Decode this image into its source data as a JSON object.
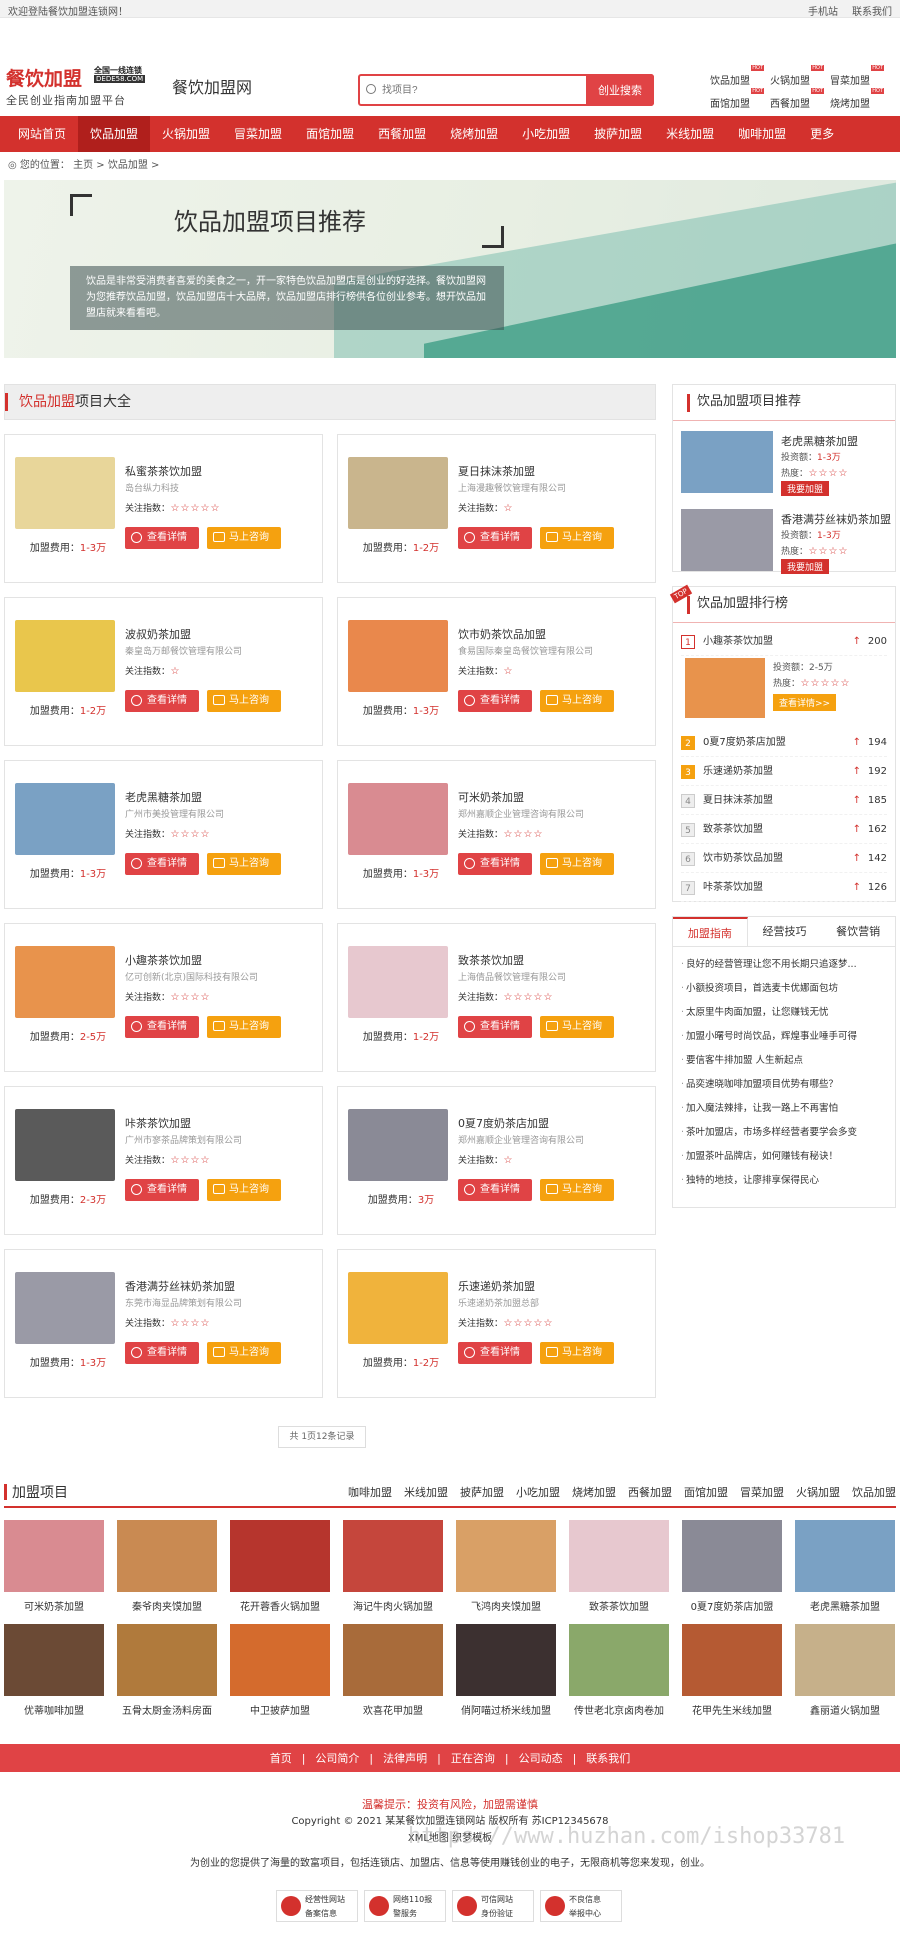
{
  "topbar": {
    "welcome": "欢迎登陆餐饮加盟连锁网！",
    "mobile": "手机站",
    "contact": "联系我们"
  },
  "header": {
    "logo_main": "餐饮加盟",
    "logo_badge": "全国一线连锁",
    "logo_domain": "DEDE58.COM",
    "logo_slogan": "全民创业指南加盟平台",
    "site_name": "餐饮加盟网",
    "search_placeholder": "找项目?",
    "search_button": "创业搜索",
    "hot_links": [
      "饮品加盟",
      "火锅加盟",
      "冒菜加盟",
      "面馆加盟",
      "西餐加盟",
      "烧烤加盟"
    ],
    "hot_tag": "HOT"
  },
  "nav": [
    "网站首页",
    "饮品加盟",
    "火锅加盟",
    "冒菜加盟",
    "面馆加盟",
    "西餐加盟",
    "烧烤加盟",
    "小吃加盟",
    "披萨加盟",
    "米线加盟",
    "咖啡加盟",
    "更多"
  ],
  "breadcrumb": {
    "prefix": "您的位置：",
    "home": "主页",
    "sep": ">",
    "current": "饮品加盟",
    "end": ">"
  },
  "banner": {
    "title": "饮品加盟项目推荐",
    "desc": "饮品是非常受消费者喜爱的美食之一，开一家特色饮品加盟店是创业的好选择。餐饮加盟网为您推荐饮品加盟，饮品加盟店十大品牌，饮品加盟店排行榜供各位创业参考。想开饮品加盟店就来看看吧。"
  },
  "list": {
    "heading_hl": "饮品加盟",
    "heading_rest": "项目大全",
    "fee_label": "加盟费用：",
    "attn_label": "关注指数：",
    "detail_btn": "查看详情",
    "consult_btn": "马上咨询",
    "pager": "共 1页12条记录",
    "items": [
      {
        "title": "私蜜茶茶饮加盟",
        "company": "岛台纵力科技",
        "fee": "1-3万",
        "stars": 5,
        "color": "#e8d69a"
      },
      {
        "title": "夏日抹沫茶加盟",
        "company": "上海漫趣餐饮管理有限公司",
        "fee": "1-2万",
        "stars": 1,
        "color": "#c9b58d"
      },
      {
        "title": "波叔奶茶加盟",
        "company": "秦皇岛万邮餐饮管理有限公司",
        "fee": "1-2万",
        "stars": 1,
        "color": "#e9c64c"
      },
      {
        "title": "饮市奶茶饮品加盟",
        "company": "食易国际秦皇岛餐饮管理有限公司",
        "fee": "1-3万",
        "stars": 1,
        "color": "#e9884c"
      },
      {
        "title": "老虎黑糖茶加盟",
        "company": "广州市美投管理有限公司",
        "fee": "1-3万",
        "stars": 4,
        "color": "#7aa1c4"
      },
      {
        "title": "可米奶茶加盟",
        "company": "郑州嘉顺企业管理咨询有限公司",
        "fee": "1-3万",
        "stars": 4,
        "color": "#d98b91"
      },
      {
        "title": "小趣茶茶饮加盟",
        "company": "亿可创新(北京)国际科技有限公司",
        "fee": "2-5万",
        "stars": 4,
        "color": "#e8934c"
      },
      {
        "title": "致茶茶饮加盟",
        "company": "上海倩品餐饮管理有限公司",
        "fee": "1-2万",
        "stars": 5,
        "color": "#e7c8cf"
      },
      {
        "title": "咔茶茶饮加盟",
        "company": "广州市寥茶品牌策划有限公司",
        "fee": "2-3万",
        "stars": 4,
        "color": "#5a5a5a"
      },
      {
        "title": "0夏7度奶茶店加盟",
        "company": "郑州嘉顺企业管理咨询有限公司",
        "fee": "3万",
        "stars": 1,
        "color": "#8a8a96"
      },
      {
        "title": "香港满芬丝袜奶茶加盟",
        "company": "东莞市海显品牌策划有限公司",
        "fee": "1-3万",
        "stars": 4,
        "color": "#9a9aa6"
      },
      {
        "title": "乐速递奶茶加盟",
        "company": "乐速递奶茶加盟总部",
        "fee": "1-2万",
        "stars": 5,
        "color": "#f0b33c"
      }
    ]
  },
  "side_rec": {
    "heading": "饮品加盟项目推荐",
    "inv_label": "投资额：",
    "heat_label": "热度：",
    "join_btn": "我要加盟",
    "items": [
      {
        "title": "老虎黑糖茶加盟",
        "inv": "1-3万",
        "stars": 4,
        "color": "#7aa1c4"
      },
      {
        "title": "香港满芬丝袜奶茶加盟",
        "inv": "1-3万",
        "stars": 4,
        "color": "#9a9aa6"
      }
    ]
  },
  "side_rank": {
    "heading": "饮品加盟排行榜",
    "top_tag": "TOP",
    "inv_label": "投资额：",
    "inv_value": "2-5万",
    "heat_label": "热度：",
    "go_btn": "查看详情>>",
    "items": [
      {
        "n": "1",
        "name": "小趣茶茶饮加盟",
        "cnt": "200"
      },
      {
        "n": "2",
        "name": "0夏7度奶茶店加盟",
        "cnt": "194"
      },
      {
        "n": "3",
        "name": "乐速递奶茶加盟",
        "cnt": "192"
      },
      {
        "n": "4",
        "name": "夏日抹沫茶加盟",
        "cnt": "185"
      },
      {
        "n": "5",
        "name": "致茶茶饮加盟",
        "cnt": "162"
      },
      {
        "n": "6",
        "name": "饮市奶茶饮品加盟",
        "cnt": "142"
      },
      {
        "n": "7",
        "name": "咔茶茶饮加盟",
        "cnt": "126"
      }
    ]
  },
  "side_tabs": {
    "tabs": [
      "加盟指南",
      "经营技巧",
      "餐饮营销"
    ],
    "items": [
      "良好的经营管理让您不用长期只追逐梦...",
      "小额投资项目，首选麦卡优娜面包坊",
      "太原里牛肉面加盟，让您赚钱无忧",
      "加盟小曙号时尚饮品，辉煌事业唾手可得",
      "要信客牛排加盟 人生新起点",
      "品奕速晓咖啡加盟项目优势有哪些？",
      "加入魔法辣排，让我一路上不再害怕",
      "茶叶加盟店，市场多样经营者要学会多变",
      "加盟茶叶品牌店，如何赚钱有秘诀！",
      "独特的地技，让廖排享保得民心"
    ]
  },
  "projects": {
    "heading": "加盟项目",
    "links": [
      "咖啡加盟",
      "米线加盟",
      "披萨加盟",
      "小吃加盟",
      "烧烤加盟",
      "西餐加盟",
      "面馆加盟",
      "冒菜加盟",
      "火锅加盟",
      "饮品加盟"
    ],
    "items": [
      {
        "name": "可米奶茶加盟",
        "color": "#d98b91"
      },
      {
        "name": "秦爷肉夹馍加盟",
        "color": "#c98a52"
      },
      {
        "name": "花开蓉香火锅加盟",
        "color": "#b6352d"
      },
      {
        "name": "海记牛肉火锅加盟",
        "color": "#c5463c"
      },
      {
        "name": "飞鸿肉夹馍加盟",
        "color": "#d9a066"
      },
      {
        "name": "致茶茶饮加盟",
        "color": "#e7c8cf"
      },
      {
        "name": "0夏7度奶茶店加盟",
        "color": "#8a8a96"
      },
      {
        "name": "老虎黑糖茶加盟",
        "color": "#7aa1c4"
      },
      {
        "name": "优蒂咖啡加盟",
        "color": "#6b4a35"
      },
      {
        "name": "五骨太厨金汤料房面",
        "color": "#b07a3c"
      },
      {
        "name": "中卫披萨加盟",
        "color": "#d46b2d"
      },
      {
        "name": "欢喜花甲加盟",
        "color": "#a86b3a"
      },
      {
        "name": "俏阿喵过桥米线加盟",
        "color": "#3c3030"
      },
      {
        "name": "传世老北京卤肉卷加",
        "color": "#8aa86a"
      },
      {
        "name": "花甲先生米线加盟",
        "color": "#b55a33"
      },
      {
        "name": "鑫丽道火锅加盟",
        "color": "#c6b08a"
      }
    ]
  },
  "footer": {
    "nav": [
      "首页",
      "公司简介",
      "法律声明",
      "正在咨询",
      "公司动态",
      "联系我们"
    ],
    "sep": "|",
    "warning": "温馨提示：投资有风险，加盟需谨慎",
    "copyright": "Copyright © 2021 某某餐饮加盟连锁网站 版权所有 苏ICP12345678",
    "sitemap": "XML地图 织梦模板",
    "desc": "为创业的您提供了海量的致富项目，包括连锁店、加盟店、信息等使用赚钱创业的电子，无限商机等您来发现，创业。",
    "badges": [
      [
        "经营性网站",
        "备案信息"
      ],
      [
        "网络110报",
        "警服务"
      ],
      [
        "可信网站",
        "身份验证"
      ],
      [
        "不良信息",
        "举报中心"
      ]
    ]
  },
  "watermark": "https://www.huzhan.com/ishop33781"
}
